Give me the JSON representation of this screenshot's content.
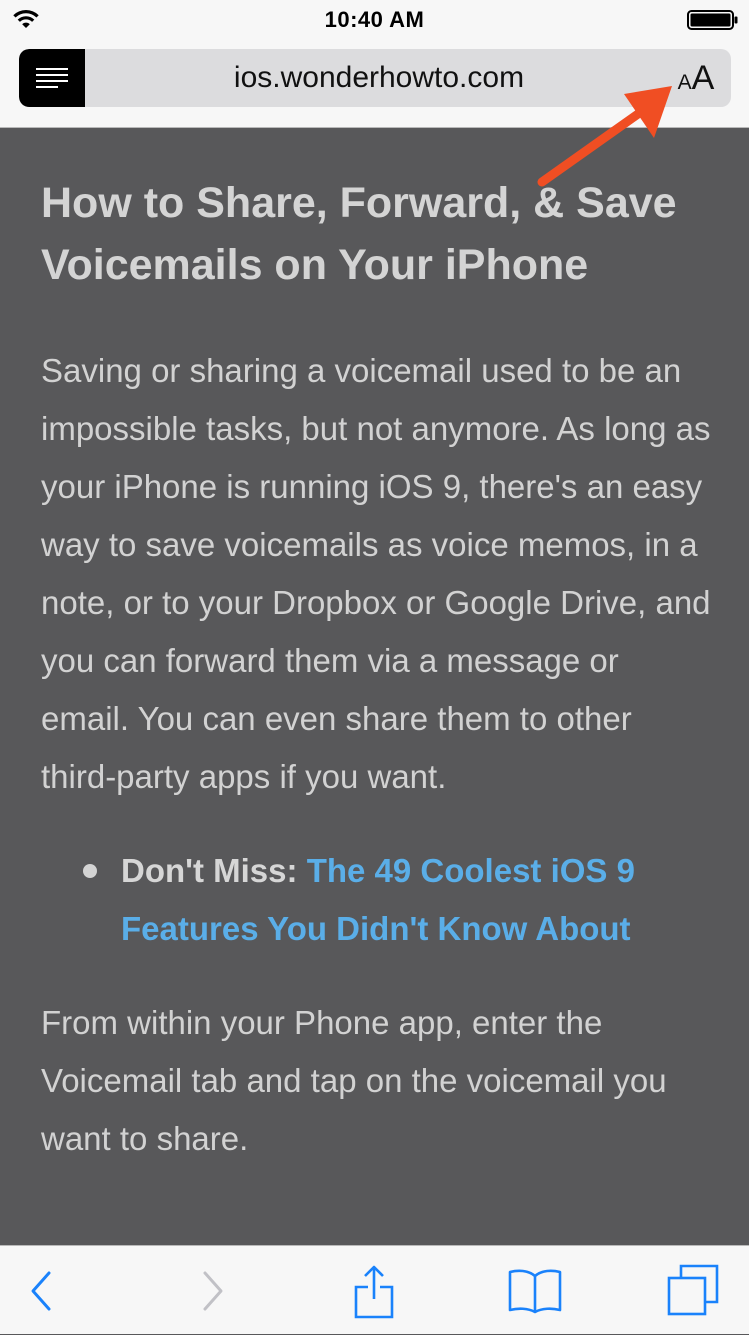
{
  "status_bar": {
    "time": "10:40 AM",
    "icons": [
      "wifi-icon",
      "battery-icon"
    ]
  },
  "address_bar": {
    "url": "ios.wonderhowto.com",
    "reader_icon": "reader-view-icon",
    "text_size_small": "A",
    "text_size_large": "A"
  },
  "article": {
    "title": "How to Share, Forward, & Save Voicemails on Your iPhone",
    "paragraph_1": "Saving or sharing a voicemail used to be an impossible tasks, but not anymore. As long as your iPhone is running iOS 9, there's an easy way to save voicemails as voice memos, in a note, or to your Dropbox or Google Drive, and you can forward them via a message or email. You can even share them to other third-party apps if you want.",
    "bullet": {
      "prefix": "Don't Miss:",
      "link_text": "The 49 Coolest iOS 9 Features You Didn't Know About"
    },
    "paragraph_2": "From within your Phone app, enter the Voicemail tab and tap on the voicemail you want to share."
  },
  "toolbar": {
    "icons": [
      "back-icon",
      "forward-icon",
      "share-icon",
      "bookmarks-icon",
      "tabs-icon"
    ]
  },
  "colors": {
    "page_background": "#58585a",
    "link": "#5aaee8",
    "ios_blue": "#1a82fb",
    "annotation_arrow": "#f04e23",
    "chrome_background": "#f7f7f7"
  }
}
